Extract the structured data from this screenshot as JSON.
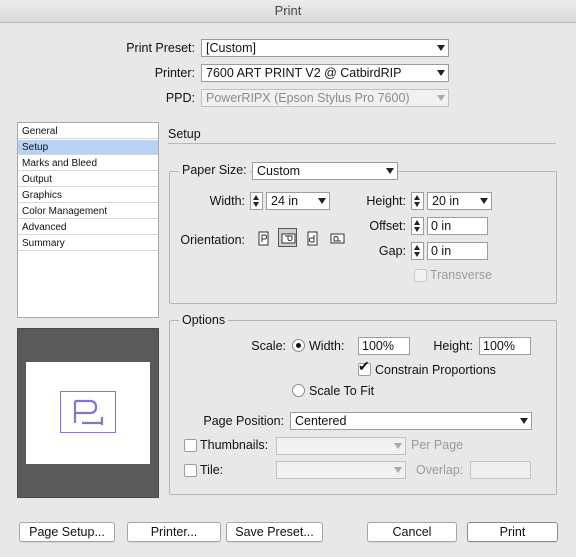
{
  "window": {
    "title": "Print"
  },
  "header": {
    "preset_label": "Print Preset:",
    "preset_value": "[Custom]",
    "printer_label": "Printer:",
    "printer_value": "7600 ART PRINT V2 @ CatbirdRIP",
    "ppd_label": "PPD:",
    "ppd_value": "PowerRIPX (Epson Stylus Pro 7600)"
  },
  "sidebar": {
    "items": [
      {
        "label": "General"
      },
      {
        "label": "Setup"
      },
      {
        "label": "Marks and Bleed"
      },
      {
        "label": "Output"
      },
      {
        "label": "Graphics"
      },
      {
        "label": "Color Management"
      },
      {
        "label": "Advanced"
      },
      {
        "label": "Summary"
      }
    ],
    "selected": "Setup"
  },
  "setup": {
    "title": "Setup",
    "paper_size_label": "Paper Size:",
    "paper_size_value": "Custom",
    "width_label": "Width:",
    "width_value": "24 in",
    "height_label": "Height:",
    "height_value": "20 in",
    "offset_label": "Offset:",
    "offset_value": "0 in",
    "gap_label": "Gap:",
    "gap_value": "0 in",
    "orientation_label": "Orientation:",
    "orientation_icons": [
      "portrait-icon",
      "landscape-icon",
      "reverse-portrait-icon",
      "reverse-landscape-icon"
    ],
    "orientation_selected": "landscape-icon",
    "transverse_label": "Transverse"
  },
  "options": {
    "legend": "Options",
    "scale_label": "Scale:",
    "width_radio_label": "Width:",
    "scale_width_value": "100%",
    "height_label": "Height:",
    "scale_height_value": "100%",
    "constrain_label": "Constrain Proportions",
    "constrain_checked": true,
    "scale_to_fit_label": "Scale To Fit",
    "page_position_label": "Page Position:",
    "page_position_value": "Centered",
    "thumbnails_label": "Thumbnails:",
    "thumbnails_value": "",
    "per_page_label": "Per Page",
    "tile_label": "Tile:",
    "tile_value": "",
    "overlap_label": "Overlap:",
    "overlap_value": ""
  },
  "buttons": {
    "page_setup": "Page Setup...",
    "printer": "Printer...",
    "save_preset": "Save Preset...",
    "cancel": "Cancel",
    "print": "Print"
  },
  "colors": {
    "selection": "#b7d2f4",
    "preview_background": "#5a5a5a",
    "preview_outline": "#8a73c7"
  }
}
